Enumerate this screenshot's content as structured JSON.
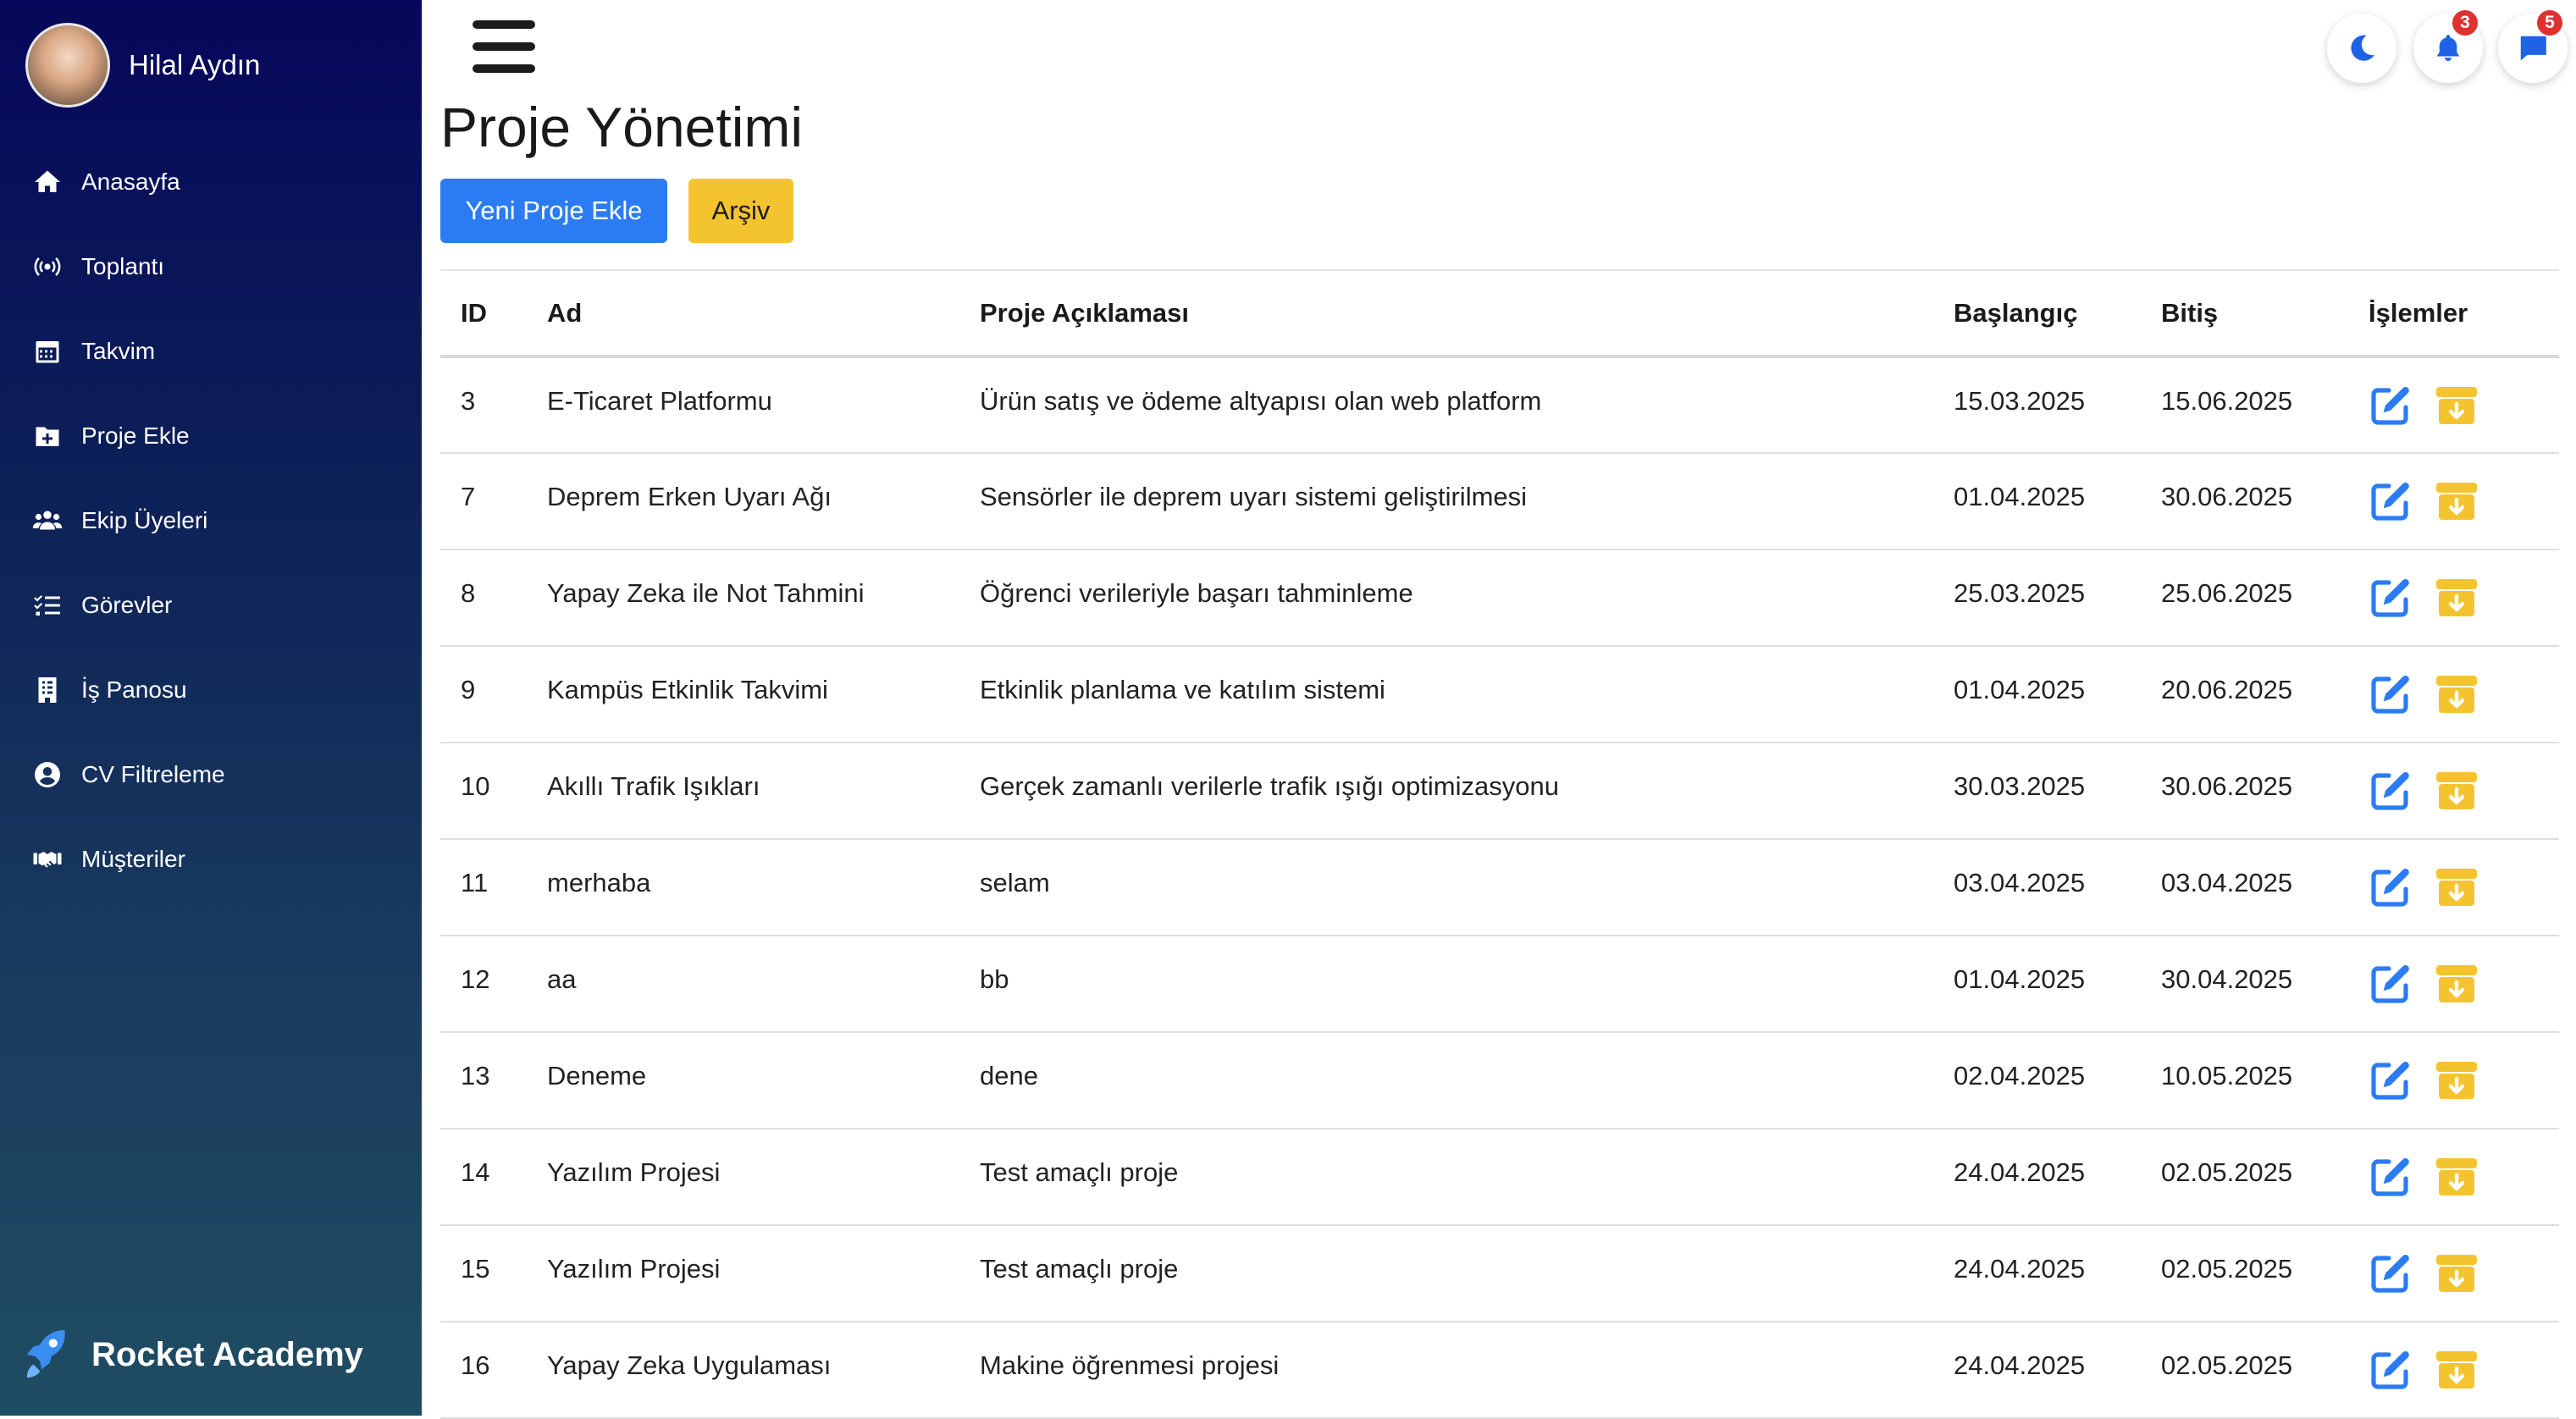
{
  "sidebar": {
    "user_name": "Hilal Aydın",
    "items": [
      {
        "label": "Anasayfa",
        "icon": "home-icon"
      },
      {
        "label": "Toplantı",
        "icon": "broadcast-icon"
      },
      {
        "label": "Takvim",
        "icon": "calendar-icon"
      },
      {
        "label": "Proje Ekle",
        "icon": "folder-plus-icon"
      },
      {
        "label": "Ekip Üyeleri",
        "icon": "users-icon"
      },
      {
        "label": "Görevler",
        "icon": "task-list-icon"
      },
      {
        "label": "İş Panosu",
        "icon": "building-icon"
      },
      {
        "label": "CV Filtreleme",
        "icon": "user-circle-icon"
      },
      {
        "label": "Müşteriler",
        "icon": "handshake-icon"
      }
    ],
    "brand": "Rocket Academy"
  },
  "header": {
    "notifications_count": "3",
    "messages_count": "5"
  },
  "main": {
    "title": "Proje Yönetimi",
    "new_project_label": "Yeni Proje Ekle",
    "archive_label": "Arşiv"
  },
  "table": {
    "columns": [
      "ID",
      "Ad",
      "Proje Açıklaması",
      "Başlangıç",
      "Bitiş",
      "İşlemler"
    ],
    "rows": [
      {
        "id": "3",
        "name": "E-Ticaret Platformu",
        "desc": "Ürün satış ve ödeme altyapısı olan web platform",
        "start": "15.03.2025",
        "end": "15.06.2025"
      },
      {
        "id": "7",
        "name": "Deprem Erken Uyarı Ağı",
        "desc": "Sensörler ile deprem uyarı sistemi geliştirilmesi",
        "start": "01.04.2025",
        "end": "30.06.2025"
      },
      {
        "id": "8",
        "name": "Yapay Zeka ile Not Tahmini",
        "desc": "Öğrenci verileriyle başarı tahminleme",
        "start": "25.03.2025",
        "end": "25.06.2025"
      },
      {
        "id": "9",
        "name": "Kampüs Etkinlik Takvimi",
        "desc": "Etkinlik planlama ve katılım sistemi",
        "start": "01.04.2025",
        "end": "20.06.2025"
      },
      {
        "id": "10",
        "name": "Akıllı Trafik Işıkları",
        "desc": "Gerçek zamanlı verilerle trafik ışığı optimizasyonu",
        "start": "30.03.2025",
        "end": "30.06.2025"
      },
      {
        "id": "11",
        "name": "merhaba",
        "desc": "selam",
        "start": "03.04.2025",
        "end": "03.04.2025"
      },
      {
        "id": "12",
        "name": "aa",
        "desc": "bb",
        "start": "01.04.2025",
        "end": "30.04.2025"
      },
      {
        "id": "13",
        "name": "Deneme",
        "desc": "dene",
        "start": "02.04.2025",
        "end": "10.05.2025"
      },
      {
        "id": "14",
        "name": "Yazılım Projesi",
        "desc": "Test amaçlı proje",
        "start": "24.04.2025",
        "end": "02.05.2025"
      },
      {
        "id": "15",
        "name": "Yazılım Projesi",
        "desc": "Test amaçlı proje",
        "start": "24.04.2025",
        "end": "02.05.2025"
      },
      {
        "id": "16",
        "name": "Yapay Zeka Uygulaması",
        "desc": "Makine öğrenmesi projesi",
        "start": "24.04.2025",
        "end": "02.05.2025"
      }
    ]
  },
  "colors": {
    "primary": "#2b7cf2",
    "warning": "#f4c430",
    "edit_icon": "#2b7cf2",
    "archive_icon": "#f4c430",
    "badge": "#e03131"
  }
}
